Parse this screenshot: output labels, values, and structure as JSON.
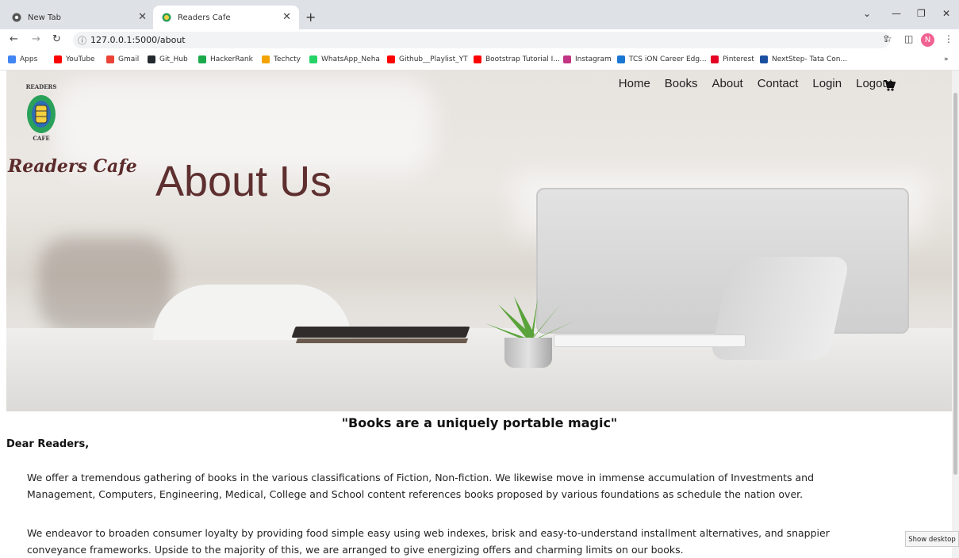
{
  "browser": {
    "tabs": [
      {
        "label": "New Tab"
      },
      {
        "label": "Readers Cafe"
      }
    ],
    "url": "127.0.0.1:5000/about",
    "avatar_letter": "N",
    "bookmarks": [
      {
        "label": "Apps",
        "color": "#4285f4"
      },
      {
        "label": "YouTube",
        "color": "#ff0000"
      },
      {
        "label": "Gmail",
        "color": "#ea4335"
      },
      {
        "label": "Git_Hub",
        "color": "#24292e"
      },
      {
        "label": "HackerRank",
        "color": "#1ba94c"
      },
      {
        "label": "Techcty",
        "color": "#f4a300"
      },
      {
        "label": "WhatsApp_Neha",
        "color": "#25d366"
      },
      {
        "label": "Github__Playlist_YT",
        "color": "#ff0000"
      },
      {
        "label": "Bootstrap Tutorial I...",
        "color": "#ff0000"
      },
      {
        "label": "Instagram",
        "color": "#c13584"
      },
      {
        "label": "TCS iON Career Edg...",
        "color": "#1976d2"
      },
      {
        "label": "Pinterest",
        "color": "#e60023"
      },
      {
        "label": "NextStep- Tata Con...",
        "color": "#1a4fa0"
      }
    ]
  },
  "site": {
    "brand": "Readers Cafe",
    "logo_top": "READERS",
    "logo_bottom": "CAFE",
    "nav": [
      "Home",
      "Books",
      "About",
      "Contact",
      "Login",
      "Logout"
    ],
    "hero_title": "About Us"
  },
  "content": {
    "quote": "\"Books are a uniquely portable magic\"",
    "greeting": "Dear Readers,",
    "paragraph1": "We offer a tremendous gathering of books in the various classifications of Fiction, Non-fiction. We likewise move in immense accumulation of Investments and Management, Computers, Engineering, Medical, College and School content references books proposed by various foundations as schedule the nation over.",
    "paragraph2": "We endeavor to broaden consumer loyalty by providing food simple easy using web indexes, brisk and easy-to-understand installment alternatives, and snappier conveyance frameworks. Upside to the majority of this, we are arranged to give energizing offers and charming limits on our books."
  },
  "taskbar": {
    "show_desktop": "Show desktop"
  }
}
